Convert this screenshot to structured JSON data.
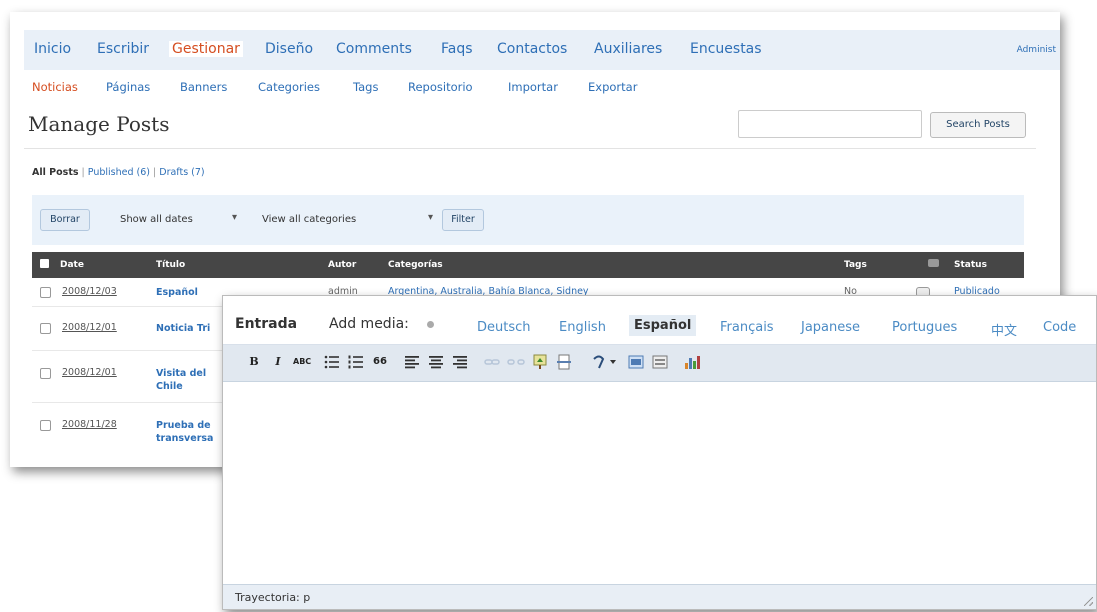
{
  "top_nav": {
    "items": [
      "Inicio",
      "Escribir",
      "Gestionar",
      "Diseño",
      "Comments",
      "Faqs",
      "Contactos",
      "Auxiliares",
      "Encuestas"
    ],
    "active": "Gestionar",
    "admin_label": "Administ"
  },
  "sub_nav": {
    "items": [
      "Noticias",
      "Páginas",
      "Banners",
      "Categories",
      "Tags",
      "Repositorio",
      "Importar",
      "Exportar"
    ],
    "active": "Noticias"
  },
  "page": {
    "title": "Manage Posts",
    "search_button": "Search Posts",
    "search_value": ""
  },
  "filters": {
    "all": "All Posts",
    "published": "Published (6)",
    "drafts": "Drafts (7)",
    "sep": "|"
  },
  "actions": {
    "delete_button": "Borrar",
    "dates_select": "Show all dates",
    "categories_select": "View all categories",
    "filter_button": "Filter"
  },
  "table": {
    "headers": [
      "Date",
      "Título",
      "Autor",
      "Categorías",
      "Tags",
      "Status"
    ],
    "rows": [
      {
        "date": "2008/12/03",
        "title": "Español",
        "author": "admin",
        "categories": "Argentina, Australia, Bahía Blanca, Sidney",
        "tags": "No",
        "status": "Publicado"
      },
      {
        "date": "2008/12/01",
        "title": "Noticia Tri",
        "author": "",
        "categories": "",
        "tags": "",
        "status": ""
      },
      {
        "date": "2008/12/01",
        "title": "Visita del",
        "title2": "Chile",
        "author": "",
        "categories": "",
        "tags": "",
        "status": ""
      },
      {
        "date": "2008/11/28",
        "title": "Prueba de",
        "title2": "transversa",
        "author": "",
        "categories": "",
        "tags": "",
        "status": ""
      }
    ]
  },
  "editor": {
    "entrada": "Entrada",
    "add_media": "Add media:",
    "languages": [
      "Deutsch",
      "English",
      "Español",
      "Français",
      "Japanese",
      "Portugues",
      "中文",
      "Code"
    ],
    "active_language": "Español",
    "toolbar": {
      "bold": "B",
      "italic": "I",
      "strike": "ABC",
      "quote": "66"
    },
    "path": "Trayectoria: p"
  },
  "icons": [
    "select-all-checkbox",
    "comments-icon",
    "media-icon",
    "bold-icon",
    "italic-icon",
    "strikethrough-icon",
    "bullet-list-icon",
    "numbered-list-icon",
    "blockquote-icon",
    "align-left-icon",
    "align-center-icon",
    "align-right-icon",
    "link-icon",
    "unlink-icon",
    "insert-image-icon",
    "more-tag-icon",
    "spellcheck-icon",
    "fullscreen-icon",
    "kitchen-sink-icon",
    "chart-icon",
    "resize-grip-icon"
  ],
  "colors": {
    "link": "#2e6fb6",
    "active": "#d54e21",
    "nav_bg": "#e9f0f8",
    "table_header": "#464646",
    "editor_bar": "#e1e8f0"
  }
}
